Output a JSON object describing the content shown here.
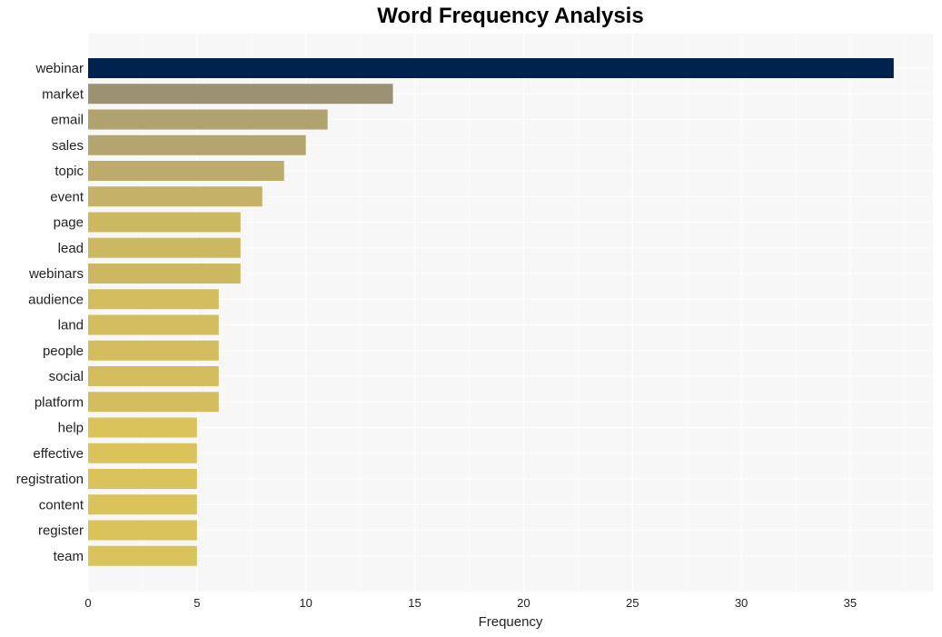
{
  "chart_data": {
    "type": "bar",
    "orientation": "horizontal",
    "title": "Word Frequency Analysis",
    "xlabel": "Frequency",
    "ylabel": "",
    "xlim": [
      0,
      38.8
    ],
    "xticks": [
      0,
      5,
      10,
      15,
      20,
      25,
      30,
      35
    ],
    "grid": true,
    "legend": "none",
    "categories": [
      "webinar",
      "market",
      "email",
      "sales",
      "topic",
      "event",
      "page",
      "lead",
      "webinars",
      "audience",
      "land",
      "people",
      "social",
      "platform",
      "help",
      "effective",
      "registration",
      "content",
      "register",
      "team"
    ],
    "values": [
      37,
      14,
      11,
      10,
      9,
      8,
      7,
      7,
      7,
      6,
      6,
      6,
      6,
      6,
      5,
      5,
      5,
      5,
      5,
      5
    ],
    "colors": [
      "#00224e",
      "#9b9173",
      "#b1a370",
      "#b4a56e",
      "#bcab6a",
      "#c5b266",
      "#cdb862",
      "#cdb862",
      "#cdb862",
      "#d4bd5f",
      "#d4bd5f",
      "#d4bd5f",
      "#d4bd5f",
      "#d4bd5f",
      "#dbc35c",
      "#dbc35c",
      "#dbc35c",
      "#dbc35c",
      "#dbc35c",
      "#dbc35c"
    ],
    "plot_background": "#f7f7f7",
    "grid_color": "#ffffff"
  }
}
